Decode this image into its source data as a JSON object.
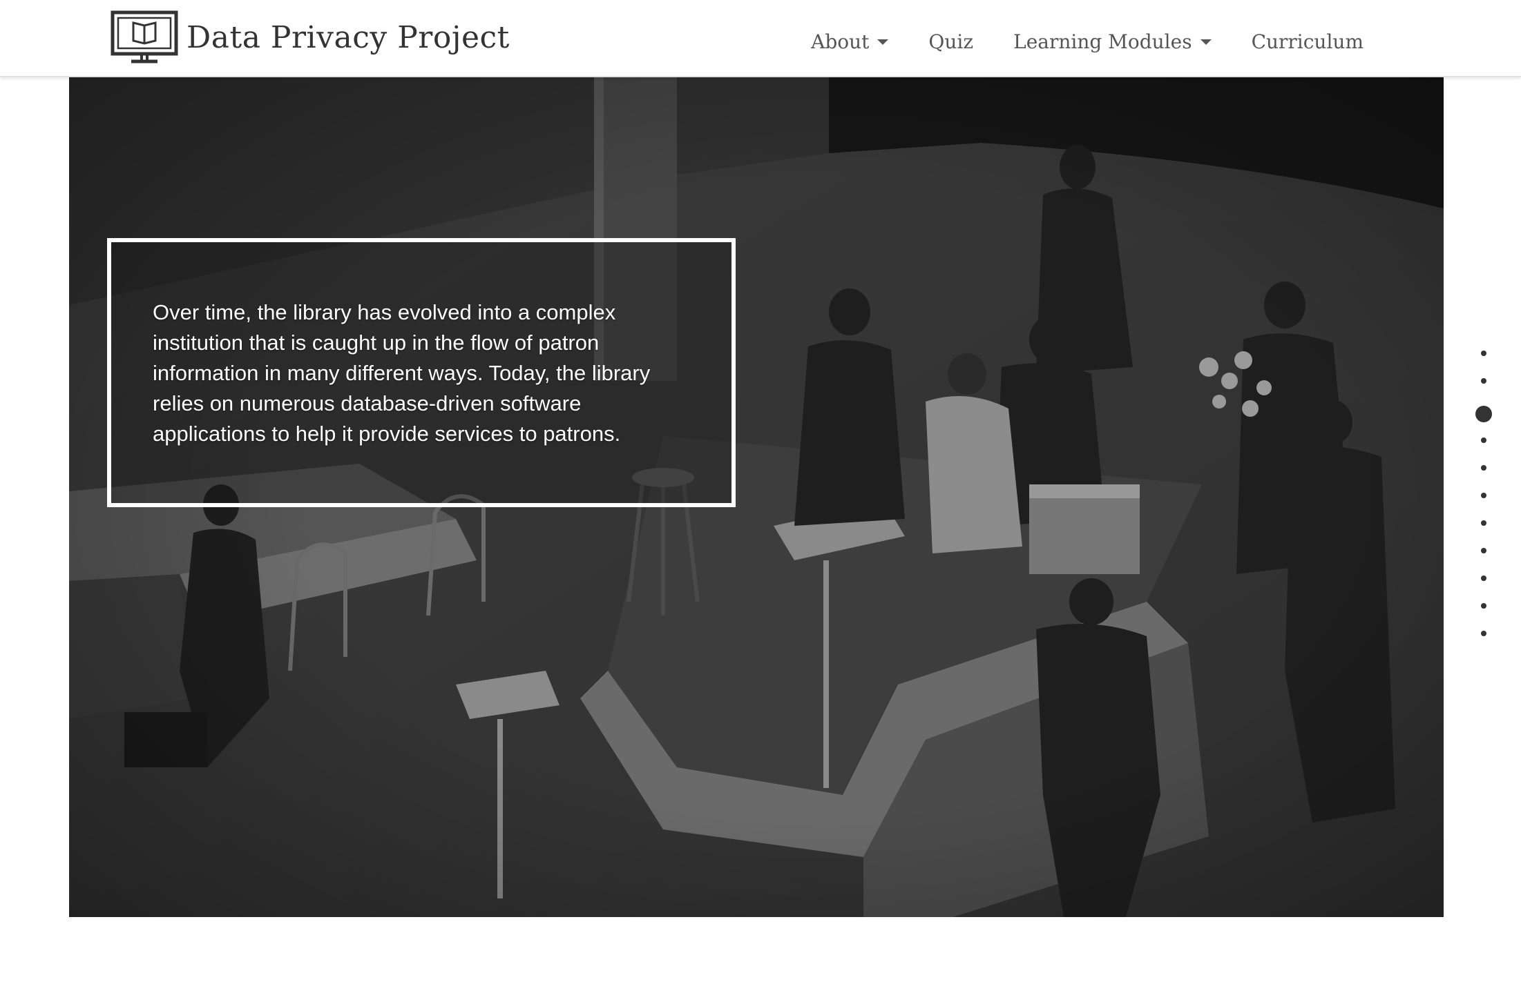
{
  "header": {
    "brand_name": "Data Privacy Project",
    "logo_icon": "computer-monitor-book-icon",
    "nav": [
      {
        "label": "About",
        "has_dropdown": true
      },
      {
        "label": "Quiz",
        "has_dropdown": false
      },
      {
        "label": "Learning Modules",
        "has_dropdown": true
      },
      {
        "label": "Curriculum",
        "has_dropdown": false
      }
    ]
  },
  "hero": {
    "photo_description_icon": "library-circulation-desk-photo",
    "text": "Over time, the library has evolved into a complex institution that is caught up in the flow of patron information in many different ways. Today, the library relies on numerous database-driven software applications to help it provide services to patrons."
  },
  "section_nav": {
    "count": 11,
    "active_index": 2
  },
  "colors": {
    "brand_text": "#333333",
    "nav_text": "#555555",
    "hero_border": "#ffffff",
    "dot": "#333333"
  }
}
